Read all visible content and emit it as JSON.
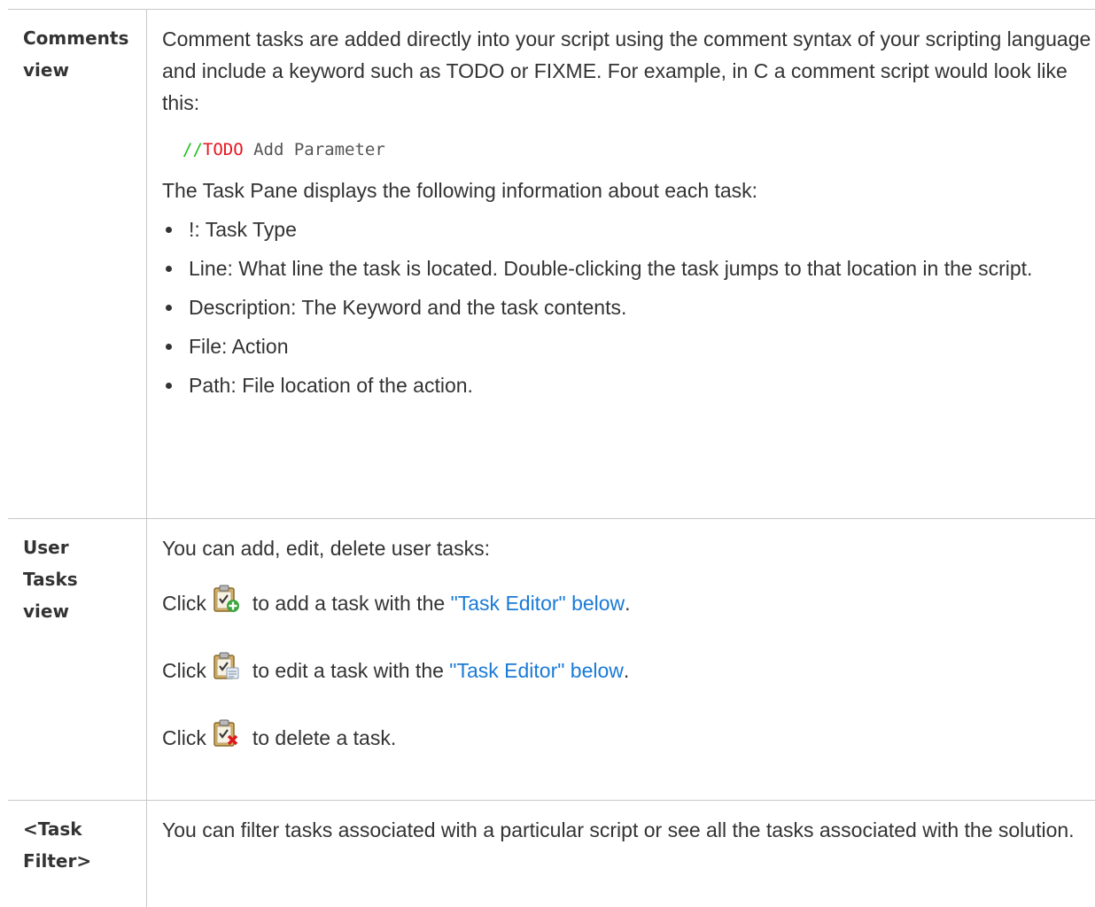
{
  "rows": [
    {
      "label_lines": [
        "Comments",
        "view"
      ],
      "intro": "Comment tasks are added directly into your script using the comment syntax of your scripting language and include a keyword such as TODO or FIXME. For example, in C a comment script would look like this:",
      "code": {
        "slashes": "//",
        "keyword": "TODO",
        "rest": " Add Parameter"
      },
      "info": "The Task Pane displays the following information about each task:",
      "bullets": [
        "!: Task Type",
        "Line: What line the task is located. Double-clicking the task jumps to that location in the script.",
        "Description: The Keyword and the task contents.",
        "File: Action",
        "Path: File location of the action."
      ]
    },
    {
      "label_lines": [
        "User",
        "Tasks",
        "view"
      ],
      "intro": "You can add, edit, delete user tasks:",
      "clicks": [
        {
          "prefix": "Click",
          "icon": "add-task-icon",
          "text_before": "to add a task with the ",
          "link": "\"Task Editor\" below",
          "text_after": "."
        },
        {
          "prefix": "Click",
          "icon": "edit-task-icon",
          "text_before": "to edit a task with the ",
          "link": "\"Task Editor\" below",
          "text_after": "."
        },
        {
          "prefix": "Click",
          "icon": "delete-task-icon",
          "text_before": "to delete a task.",
          "link": "",
          "text_after": ""
        }
      ]
    },
    {
      "label_lines": [
        "<Task",
        "Filter>"
      ],
      "intro": "You can filter tasks associated with a particular script or see all the tasks associated with the solution."
    }
  ],
  "colors": {
    "link": "#1a7ad6",
    "code_comment": "#1ec01e",
    "code_keyword": "#e8141e",
    "border": "#c8c8c8",
    "text": "#333333"
  }
}
